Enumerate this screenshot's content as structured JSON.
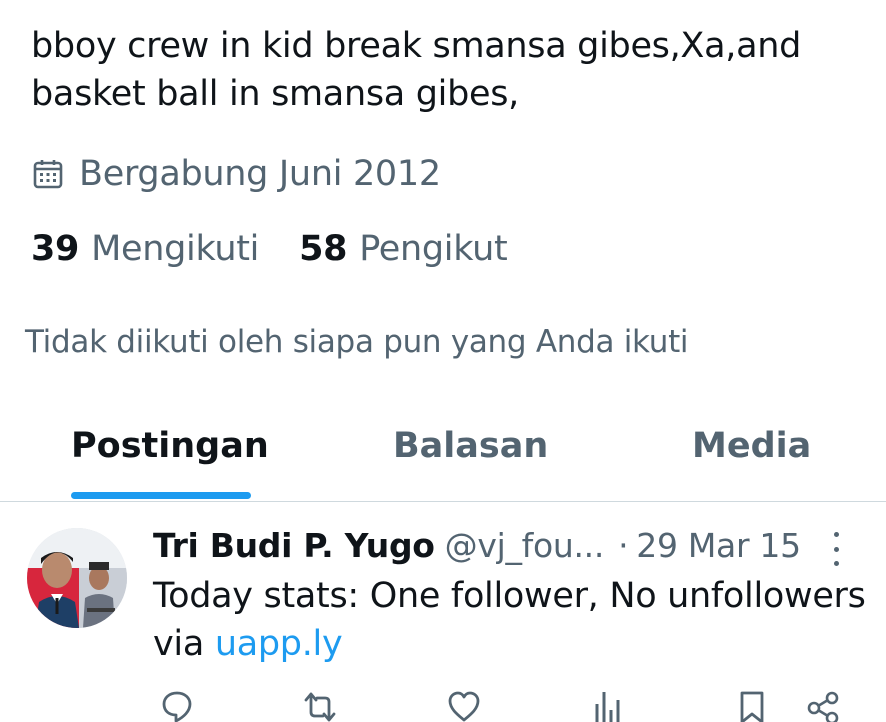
{
  "profile": {
    "bio_line1": "bboy crew in kid break smansa gibes,Xa,and",
    "bio_line2": "basket ball in smansa gibes,",
    "joined_icon": "calendar-icon",
    "joined_text": "Bergabung Juni 2012",
    "following_count": "39",
    "following_label": "Mengikuti",
    "followers_count": "58",
    "followers_label": "Pengikut",
    "not_followed_text": "Tidak diikuti oleh siapa pun yang Anda ikuti"
  },
  "tabs": [
    {
      "label": "Postingan",
      "active": true
    },
    {
      "label": "Balasan",
      "active": false
    },
    {
      "label": "Media",
      "active": false
    }
  ],
  "colors": {
    "accent": "#1d9bf0",
    "text_primary": "#0f1419",
    "text_secondary": "#536471",
    "divider": "#cfd9de"
  },
  "post": {
    "author_name": "Tri Budi P. Yugo",
    "handle": "@vj_fou...",
    "separator": "·",
    "date": "29 Mar 15",
    "text_line1": "Today stats: One follower, No unfollowers",
    "text_via": "via",
    "text_link": "uapp.ly",
    "more_icon": "more-options-icon",
    "actions": [
      "reply-icon",
      "retweet-icon",
      "like-icon",
      "views-icon",
      "bookmark-icon",
      "share-icon"
    ]
  }
}
